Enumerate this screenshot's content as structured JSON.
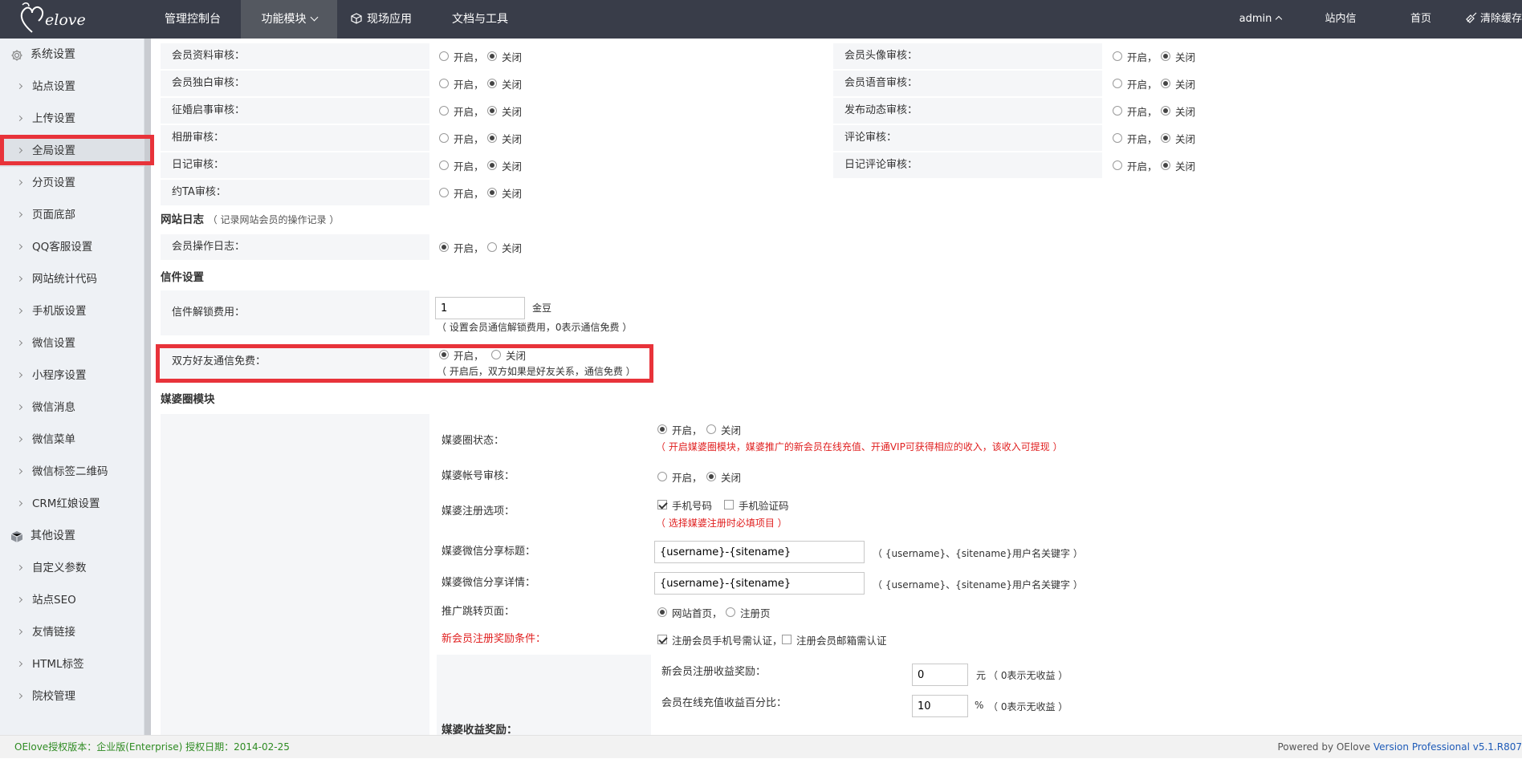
{
  "brand": {
    "logo_text": "elove"
  },
  "topnav": {
    "items": [
      "管理控制台",
      "功能模块",
      "现场应用",
      "文档与工具"
    ],
    "right": [
      "admin",
      "站内信",
      "首页",
      "清除缓存"
    ]
  },
  "sidebar": {
    "group1": "系统设置",
    "items1": [
      "站点设置",
      "上传设置",
      "全局设置",
      "分页设置",
      "页面底部",
      "QQ客服设置",
      "网站统计代码",
      "手机版设置",
      "微信设置",
      "小程序设置",
      "微信消息",
      "微信菜单",
      "微信标签二维码",
      "CRM红娘设置"
    ],
    "group2": "其他设置",
    "items2": [
      "自定义参数",
      "站点SEO",
      "友情链接",
      "HTML标签",
      "院校管理"
    ]
  },
  "radio": {
    "on": "开启，",
    "off": "关闭"
  },
  "audit": {
    "left": [
      "会员资料审核：",
      "会员独白审核：",
      "征婚启事审核：",
      "相册审核：",
      "日记审核：",
      "约TA审核："
    ],
    "right": [
      "会员头像审核：",
      "会员语音审核：",
      "发布动态审核：",
      "评论审核：",
      "日记评论审核："
    ]
  },
  "log": {
    "title": "网站日志",
    "subtitle": "（ 记录网站会员的操作记录 ）",
    "label": "会员操作日志："
  },
  "mail": {
    "title": "信件设置",
    "fee_label": "信件解锁费用：",
    "fee_value": "1",
    "fee_unit": "金豆",
    "fee_hint": "（ 设置会员通信解锁费用，0表示通信免费 ）",
    "free_label": "双方好友通信免费：",
    "free_hint": "（ 开启后，双方如果是好友关系，通信免费 ）"
  },
  "matchmaker": {
    "title": "媒婆圈模块",
    "status_label": "媒婆圈状态：",
    "status_hint": "（ 开启媒婆圈模块，媒婆推广的新会员在线充值、开通VIP可获得相应的收入，该收入可提现 ）",
    "audit_label": "媒婆帐号审核：",
    "reg_label": "媒婆注册选项：",
    "reg_opt1": "手机号码",
    "reg_opt2": "手机验证码",
    "reg_hint": "（ 选择媒婆注册时必填项目 ）",
    "share_title_label": "媒婆微信分享标题：",
    "share_title_value": "{username}-{sitename}",
    "share_title_hint": "（ {username}、{sitename}用户名关键字 ）",
    "share_detail_label": "媒婆微信分享详情：",
    "share_detail_value": "{username}-{sitename}",
    "share_detail_hint": "（ {username}、{sitename}用户名关键字 ）",
    "redirect_label": "推广跳转页面：",
    "redirect_opt1": "网站首页，",
    "redirect_opt2": "注册页",
    "reward_cond_label": "新会员注册奖励条件：",
    "reward_cond1": "注册会员手机号需认证，",
    "reward_cond2": "注册会员邮箱需认证",
    "income_label": "媒婆收益奖励：",
    "income": [
      {
        "label": "新会员注册收益奖励：",
        "value": "0",
        "unit": "元",
        "hint": "（ 0表示无收益 ）"
      },
      {
        "label": "会员在线充值收益百分比：",
        "value": "10",
        "unit": "%",
        "hint": "（ 0表示无收益 ）"
      }
    ]
  },
  "footer": {
    "left": "OElove授权版本：企业版(Enterprise) 授权日期：2014-02-25",
    "right_prefix": "Powered by OElove ",
    "right_version": "Version Professional v5.1.R807"
  },
  "colors": {
    "topbar": "#393d49",
    "highlight": "#e8333a",
    "hint_red": "#e02020",
    "footer_green": "#2e8b22"
  }
}
